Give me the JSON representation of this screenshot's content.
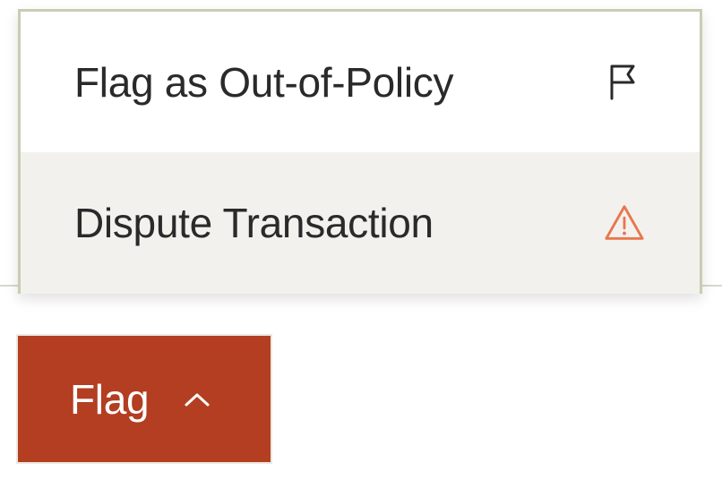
{
  "menu": {
    "items": [
      {
        "label": "Flag as Out-of-Policy",
        "icon": "flag-icon"
      },
      {
        "label": "Dispute Transaction",
        "icon": "warning-icon",
        "icon_color": "#e8774b"
      }
    ]
  },
  "button": {
    "label": "Flag",
    "icon": "chevron-up-icon",
    "background": "#b33e21"
  }
}
